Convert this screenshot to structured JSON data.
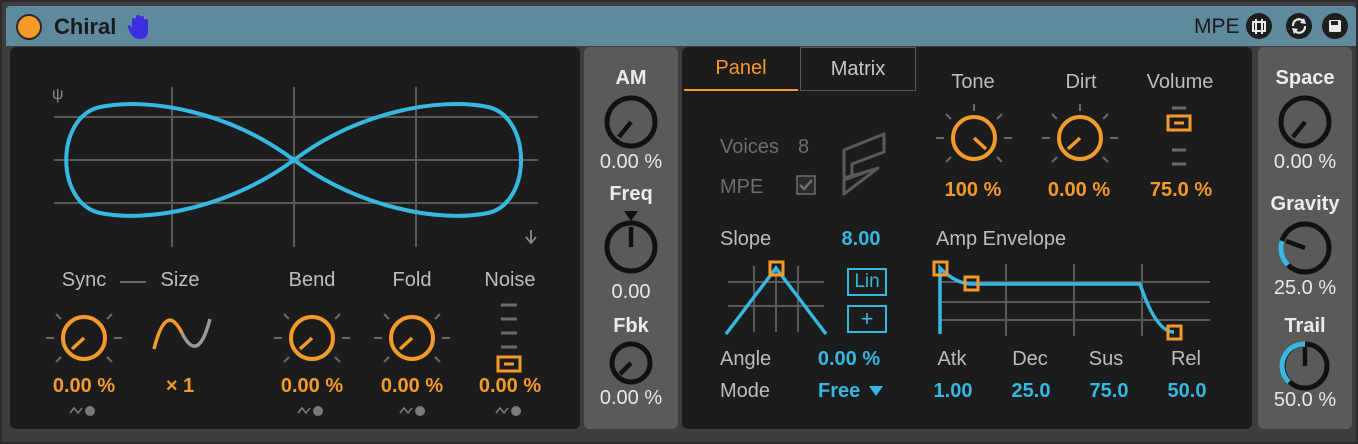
{
  "device": {
    "title": "Chiral",
    "mpe_label": "MPE",
    "colors": {
      "accent": "#f39a2a",
      "blue": "#36b8e0",
      "titlebar": "#5f8a9e"
    },
    "title_buttons": [
      "map-icon",
      "refresh-icon",
      "save-icon"
    ]
  },
  "osc": {
    "labels": {
      "sync": "Sync",
      "size": "Size",
      "bend": "Bend",
      "fold": "Fold",
      "noise": "Noise"
    },
    "values": {
      "sync": "0.00 %",
      "size": "× 1",
      "bend": "0.00 %",
      "fold": "0.00 %",
      "noise": "0.00 %"
    }
  },
  "mod": {
    "am_label": "AM",
    "am_value": "0.00 %",
    "freq_label": "Freq",
    "freq_value": "0.00",
    "fbk_label": "Fbk",
    "fbk_value": "0.00 %"
  },
  "panel": {
    "tabs": [
      "Panel",
      "Matrix"
    ],
    "voices_label": "Voices",
    "voices_value": "8",
    "mpe_label": "MPE",
    "tone_label": "Tone",
    "tone_value": "100 %",
    "dirt_label": "Dirt",
    "dirt_value": "0.00 %",
    "volume_label": "Volume",
    "volume_value": "75.0 %",
    "slope_label": "Slope",
    "slope_value": "8.00",
    "lin_label": "Lin",
    "plus_label": "+",
    "angle_label": "Angle",
    "angle_value": "0.00 %",
    "mode_label": "Mode",
    "mode_value": "Free",
    "amp_label": "Amp Envelope",
    "env": {
      "atk_label": "Atk",
      "atk_value": "1.00",
      "dec_label": "Dec",
      "dec_value": "25.0",
      "sus_label": "Sus",
      "sus_value": "75.0",
      "rel_label": "Rel",
      "rel_value": "50.0"
    }
  },
  "space": {
    "space_label": "Space",
    "space_value": "0.00 %",
    "gravity_label": "Gravity",
    "gravity_value": "25.0 %",
    "trail_label": "Trail",
    "trail_value": "50.0 %"
  }
}
